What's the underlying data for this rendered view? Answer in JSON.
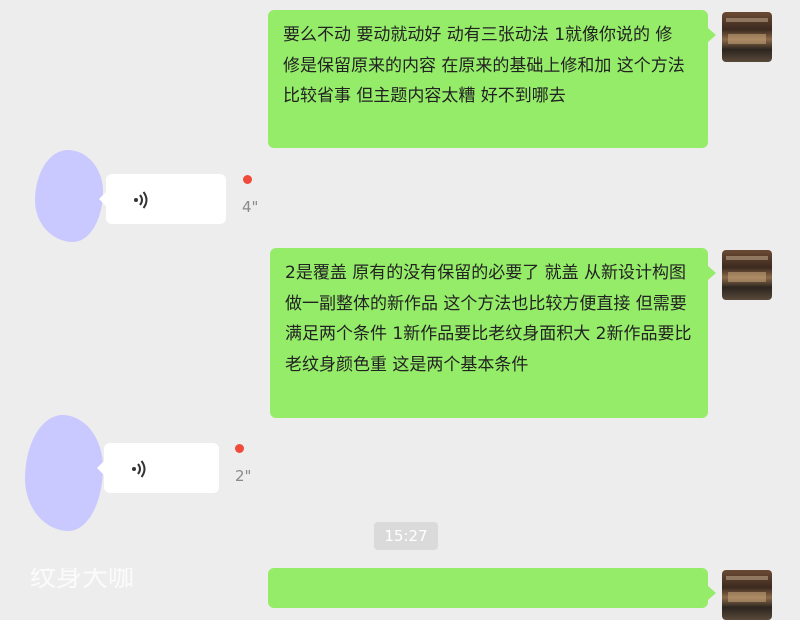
{
  "messages": [
    {
      "side": "right",
      "text": "要么不动 要动就动好 动有三张动法 1就像你说的 修 修是保留原来的内容 在原来的基础上修和加 这个方法比较省事 但主题内容太糟 好不到哪去"
    },
    {
      "side": "left",
      "type": "voice",
      "duration": "4\"",
      "unread": true
    },
    {
      "side": "right",
      "text": "2是覆盖 原有的没有保留的必要了 就盖 从新设计构图做一副整体的新作品 这个方法也比较方便直接 但需要满足两个条件 1新作品要比老纹身面积大 2新作品要比老纹身颜色重 这是两个基本条件"
    },
    {
      "side": "left",
      "type": "voice",
      "duration": "2\"",
      "unread": true
    }
  ],
  "timestamp": "15:27",
  "watermark": "纹身大咖",
  "colors": {
    "background": "#ededed",
    "self_bubble": "#95ec69",
    "other_bubble": "#ffffff",
    "unread_dot": "#f04a3a",
    "timestamp_bg": "#dadada"
  }
}
